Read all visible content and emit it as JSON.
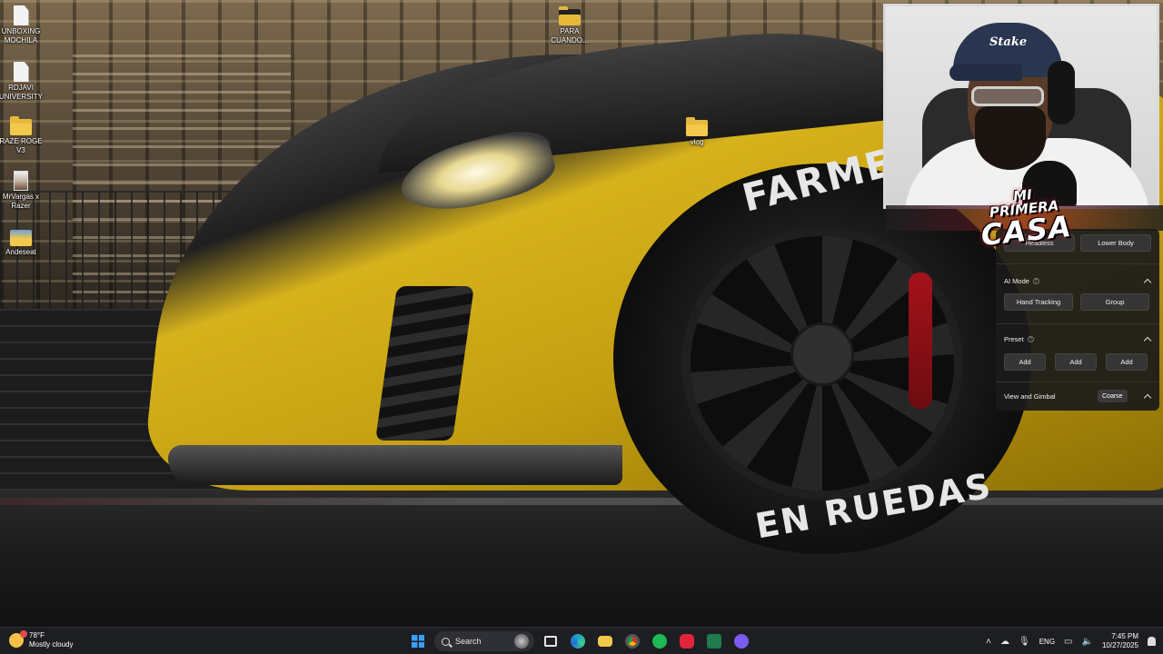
{
  "desktop": {
    "icons": [
      {
        "label": "UNBOXING\nMOCHILA",
        "type": "document-icon"
      },
      {
        "label": "RDJAVI\nUNIVERSITY",
        "type": "document-icon"
      },
      {
        "label": "RAZE ROGE\nV3",
        "type": "folder-icon"
      },
      {
        "label": "MrVargas x\nRazer",
        "type": "image-file-icon"
      },
      {
        "label": "Andeseat",
        "type": "image-folder-icon"
      },
      {
        "label": "PARA\nCUANDO...",
        "type": "folder-icon"
      },
      {
        "label": "vlog",
        "type": "folder-icon"
      }
    ]
  },
  "wallpaper": {
    "tire_text_top": "FARMEC",
    "tire_text_bottom": "EN RUEDAS"
  },
  "webcam": {
    "cap_logo": "Stake",
    "overlay_line1": "MI PRIMERA",
    "overlay_line2": "CASA"
  },
  "panel": {
    "body_buttons": [
      "Headless",
      "Lower Body"
    ],
    "ai_mode": {
      "title": "AI Mode",
      "buttons": [
        "Hand Tracking",
        "Group"
      ]
    },
    "preset": {
      "title": "Preset",
      "buttons": [
        "Add",
        "Add",
        "Add"
      ]
    },
    "view_gimbal": {
      "title": "View and Gimbal",
      "value": "Coarse"
    }
  },
  "taskbar": {
    "weather_temp": "78°F",
    "weather_desc": "Mostly cloudy",
    "search_label": "Search",
    "language": "ENG",
    "time": "7:45 PM",
    "date": "10/27/2025",
    "pinned_apps": [
      {
        "name": "start-button",
        "color": "#3aa0ff"
      },
      {
        "name": "task-view",
        "color": "#e5e5e5"
      },
      {
        "name": "edge",
        "color": "#1fa3c7"
      },
      {
        "name": "file-explorer",
        "color": "#f2c94c"
      },
      {
        "name": "chrome",
        "color": "#c9c9c9"
      },
      {
        "name": "spotify",
        "color": "#1db954"
      },
      {
        "name": "app-red",
        "color": "#e0243a"
      },
      {
        "name": "excel",
        "color": "#1f7a4d"
      },
      {
        "name": "discord",
        "color": "#7b5cf0"
      }
    ]
  }
}
